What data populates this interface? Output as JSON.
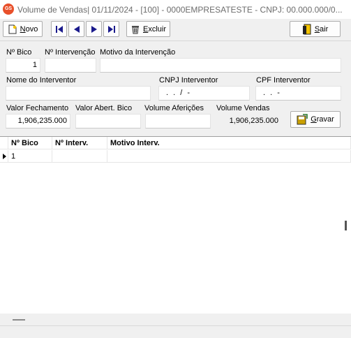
{
  "window": {
    "title": "Volume de Vendas|  01/11/2024 - [100] - 0000EMPRESATESTE - CNPJ: 00.000.000/0...",
    "app_icon_text": "GS"
  },
  "toolbar": {
    "novo": "Novo",
    "excluir": "Excluir",
    "sair": "Sair"
  },
  "form": {
    "labels": {
      "n_bico": "Nº Bico",
      "n_intervencao": "Nº Intervenção",
      "motivo": "Motivo da Intervenção",
      "nome_interventor": "Nome do Interventor",
      "cnpj_interventor": "CNPJ Interventor",
      "cpf_interventor": "CPF Interventor",
      "valor_fechamento": "Valor Fechamento",
      "valor_abert_bico": "Valor Abert. Bico",
      "volume_afericoes": "Volume Aferições",
      "volume_vendas": "Volume Vendas"
    },
    "values": {
      "n_bico": "1",
      "n_intervencao": "",
      "motivo": "",
      "nome_interventor": "",
      "cnpj_interventor": ". . / -",
      "cpf_interventor": ". . -",
      "valor_fechamento": "1,906,235.000",
      "valor_abert_bico": "",
      "volume_afericoes": "",
      "volume_vendas": "1,906,235.000"
    },
    "gravar": "Gravar"
  },
  "grid": {
    "columns": [
      "Nº Bico",
      "Nº Interv.",
      "Motivo Interv."
    ],
    "rows": [
      [
        "1",
        "",
        ""
      ]
    ]
  }
}
